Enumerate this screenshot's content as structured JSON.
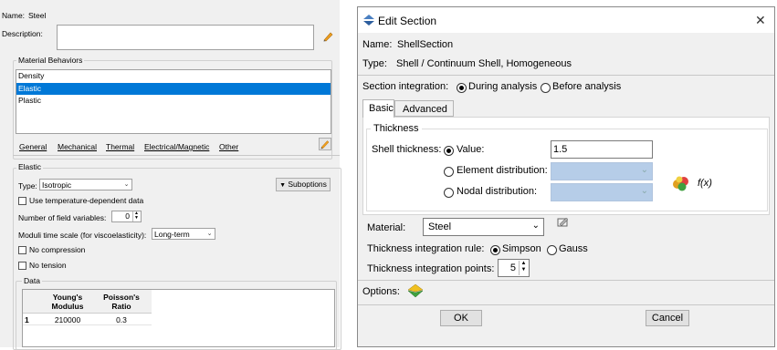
{
  "left": {
    "name_label": "Name:",
    "name_value": "Steel",
    "description_label": "Description:",
    "behaviors_title": "Material Behaviors",
    "behaviors": [
      "Density",
      "Elastic",
      "Plastic"
    ],
    "selected_behavior_index": 1,
    "menus": [
      "General",
      "Mechanical",
      "Thermal",
      "Electrical/Magnetic",
      "Other"
    ],
    "elastic_title": "Elastic",
    "type_label": "Type:",
    "type_value": "Isotropic",
    "suboptions_label": "Suboptions",
    "temp_dependent_label": "Use temperature-dependent data",
    "field_vars_label": "Number of field variables:",
    "field_vars_value": "0",
    "moduli_label": "Moduli time scale (for viscoelasticity):",
    "moduli_value": "Long-term",
    "no_compression_label": "No compression",
    "no_tension_label": "No tension",
    "data_title": "Data",
    "table": {
      "headers": [
        [
          "Young's",
          "Modulus"
        ],
        [
          "Poisson's",
          "Ratio"
        ]
      ],
      "rows": [
        {
          "index": "1",
          "cells": [
            "210000",
            "0.3"
          ]
        }
      ]
    }
  },
  "dialog": {
    "title": "Edit Section",
    "name_label": "Name:",
    "name_value": "ShellSection",
    "type_label": "Type:",
    "type_value": "Shell / Continuum Shell, Homogeneous",
    "integration_label": "Section integration:",
    "integration_options": [
      "During analysis",
      "Before analysis"
    ],
    "tabs": [
      "Basic",
      "Advanced"
    ],
    "thickness_group": "Thickness",
    "shell_thickness_label": "Shell thickness:",
    "thickness_options": [
      "Value:",
      "Element distribution:",
      "Nodal distribution:"
    ],
    "thickness_value": "1.5",
    "fx_label": "f(x)",
    "material_label": "Material:",
    "material_value": "Steel",
    "rule_label": "Thickness integration rule:",
    "rule_options": [
      "Simpson",
      "Gauss"
    ],
    "points_label": "Thickness integration points:",
    "points_value": "5",
    "options_label": "Options:",
    "ok_label": "OK",
    "cancel_label": "Cancel"
  }
}
